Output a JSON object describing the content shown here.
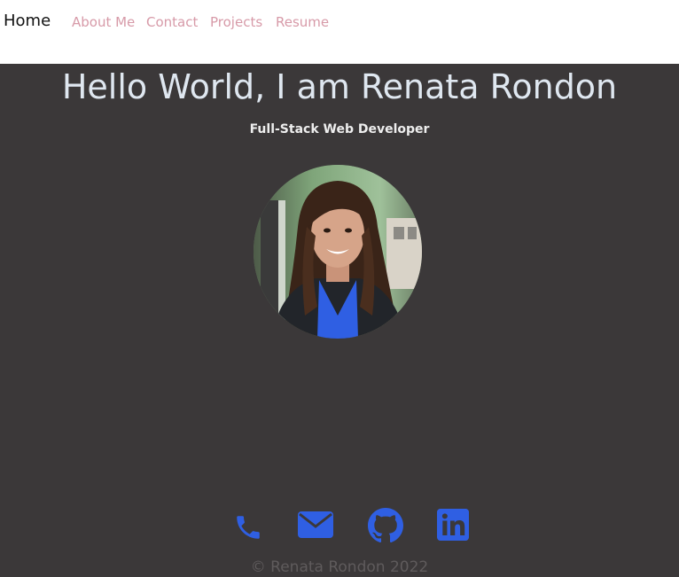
{
  "nav": {
    "home": "Home",
    "links": [
      "About Me",
      "Contact",
      "Projects",
      "Resume"
    ]
  },
  "hero": {
    "title": "Hello World, I am Renata Rondon",
    "subtitle": "Full-Stack Web Developer"
  },
  "social": {
    "icons": [
      "phone-icon",
      "envelope-icon",
      "github-icon",
      "linkedin-icon"
    ],
    "color": "#2f5fe3"
  },
  "footer": {
    "text": "© Renata Rondon 2022"
  },
  "colors": {
    "background": "#3b3839",
    "nav_background": "#ffffff",
    "nav_link": "#d79aa8",
    "title": "#dfe7f0"
  }
}
